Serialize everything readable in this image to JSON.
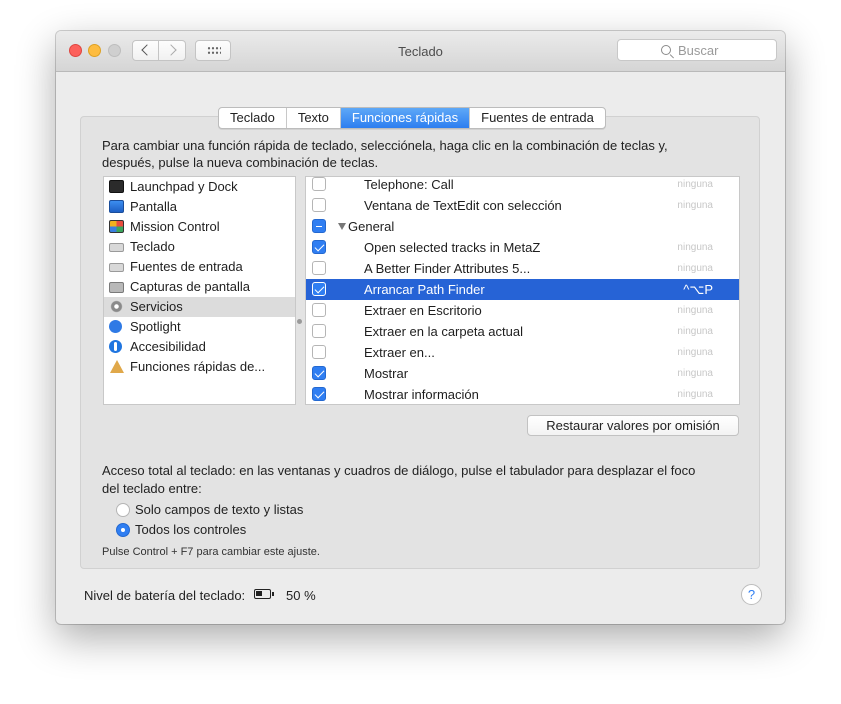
{
  "window": {
    "title": "Teclado"
  },
  "toolbar": {
    "search_placeholder": "Buscar"
  },
  "tabs": [
    {
      "label": "Teclado",
      "selected": false
    },
    {
      "label": "Texto",
      "selected": false
    },
    {
      "label": "Funciones rápidas",
      "selected": true
    },
    {
      "label": "Fuentes de entrada",
      "selected": false
    }
  ],
  "intro_line1": "Para cambiar una función rápida de teclado, selecciónela, haga clic en la combinación de teclas y,",
  "intro_line2": "después, pulse la nueva combinación de teclas.",
  "categories": [
    {
      "label": "Launchpad y Dock",
      "icon": "launchpad-icon",
      "selected": false
    },
    {
      "label": "Pantalla",
      "icon": "display-icon",
      "selected": false
    },
    {
      "label": "Mission Control",
      "icon": "mission-control-icon",
      "selected": false
    },
    {
      "label": "Teclado",
      "icon": "keyboard-icon",
      "selected": false
    },
    {
      "label": "Fuentes de entrada",
      "icon": "keyboard-icon",
      "selected": false
    },
    {
      "label": "Capturas de pantalla",
      "icon": "camera-icon",
      "selected": false
    },
    {
      "label": "Servicios",
      "icon": "gear-icon",
      "selected": true
    },
    {
      "label": "Spotlight",
      "icon": "spotlight-icon",
      "selected": false
    },
    {
      "label": "Accesibilidad",
      "icon": "accessibility-icon",
      "selected": false
    },
    {
      "label": "Funciones rápidas de...",
      "icon": "app-shortcuts-icon",
      "selected": false
    }
  ],
  "shortcuts": [
    {
      "label": "Telephone: Call",
      "shortcut": "ninguna",
      "state": "off",
      "group": false,
      "selected": false
    },
    {
      "label": "Ventana de TextEdit con selección",
      "shortcut": "ninguna",
      "state": "off",
      "group": false,
      "selected": false
    },
    {
      "label": "General",
      "shortcut": "",
      "state": "mixed",
      "group": true,
      "selected": false
    },
    {
      "label": "Open selected tracks in MetaZ",
      "shortcut": "ninguna",
      "state": "on",
      "group": false,
      "selected": false
    },
    {
      "label": "A Better Finder Attributes 5...",
      "shortcut": "ninguna",
      "state": "off",
      "group": false,
      "selected": false
    },
    {
      "label": "Arrancar Path Finder",
      "shortcut": "^⌥P",
      "state": "on",
      "group": false,
      "selected": true
    },
    {
      "label": "Extraer en Escritorio",
      "shortcut": "ninguna",
      "state": "off",
      "group": false,
      "selected": false
    },
    {
      "label": "Extraer en la carpeta actual",
      "shortcut": "ninguna",
      "state": "off",
      "group": false,
      "selected": false
    },
    {
      "label": "Extraer en...",
      "shortcut": "ninguna",
      "state": "off",
      "group": false,
      "selected": false
    },
    {
      "label": "Mostrar",
      "shortcut": "ninguna",
      "state": "on",
      "group": false,
      "selected": false
    },
    {
      "label": "Mostrar información",
      "shortcut": "ninguna",
      "state": "on",
      "group": false,
      "selected": false
    }
  ],
  "restore_button": "Restaurar valores por omisión",
  "access_line1": "Acceso total al teclado: en las ventanas y cuadros de diálogo, pulse el tabulador para desplazar el foco",
  "access_line2": "del teclado entre:",
  "radio_options": [
    {
      "label": "Solo campos de texto y listas",
      "selected": false
    },
    {
      "label": "Todos los controles",
      "selected": true
    }
  ],
  "hint": "Pulse Control + F7 para cambiar este ajuste.",
  "battery": {
    "label": "Nivel de batería del teclado:",
    "value": "50 %",
    "level": 0.5
  },
  "help_label": "?"
}
